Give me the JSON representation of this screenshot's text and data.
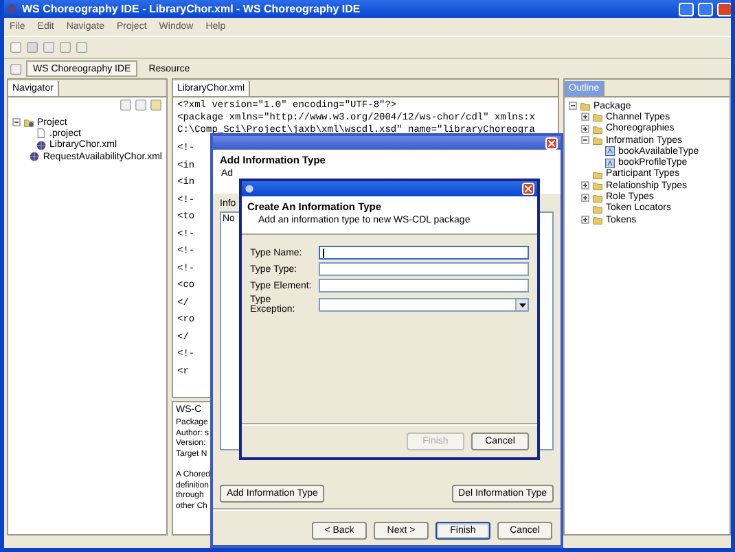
{
  "window": {
    "title": "WS Choreography IDE - LibraryChor.xml - WS Choreography IDE"
  },
  "menu": [
    "File",
    "Edit",
    "Navigate",
    "Project",
    "Window",
    "Help"
  ],
  "perspectives": [
    {
      "label": "WS Choreography IDE",
      "selected": true
    },
    {
      "label": "Resource",
      "selected": false
    }
  ],
  "navigator": {
    "title": "Navigator",
    "tree": [
      {
        "label": "Project",
        "kind": "project",
        "expanded": true,
        "children": [
          {
            "label": ".project",
            "kind": "file"
          },
          {
            "label": "LibraryChor.xml",
            "kind": "chor"
          },
          {
            "label": "RequestAvailabilityChor.xml",
            "kind": "chor"
          }
        ]
      }
    ]
  },
  "editor": {
    "tab": "LibraryChor.xml",
    "header_lines": [
      "<?xml version=\"1.0\" encoding=\"UTF-8\"?>",
      "<package xmlns=\"http://www.w3.org/2004/12/ws-chor/cdl\" xmlns:x",
      "C:\\Comp_Sci\\Project\\jaxb\\xml\\wscdl.xsd\" name=\"libraryChoreogra"
    ],
    "lines": [
      "<!-",
      "<in",
      "<in",
      "<!-",
      "<to",
      "<!-",
      "<!-",
      "<!-",
      "<co",
      "</",
      "<ro",
      "</",
      "<!-",
      "<r"
    ]
  },
  "properties": {
    "tab": "WS-C",
    "lines": [
      "Package",
      "Author: s",
      "Version:",
      "Target N"
    ],
    "description": [
      "A Chored",
      "definition",
      "through",
      "other Ch"
    ]
  },
  "outline": {
    "title": "Outline",
    "tree": [
      {
        "label": "Package",
        "kind": "folder",
        "expanded": true,
        "children": [
          {
            "label": "Channel Types",
            "kind": "folder",
            "expanded": false
          },
          {
            "label": "Choreographies",
            "kind": "folder",
            "expanded": false
          },
          {
            "label": "Information Types",
            "kind": "folder",
            "expanded": true,
            "children": [
              {
                "label": "bookAvailableType",
                "kind": "type"
              },
              {
                "label": "bookProfileType",
                "kind": "type"
              }
            ]
          },
          {
            "label": "Participant Types",
            "kind": "empty-folder"
          },
          {
            "label": "Relationship Types",
            "kind": "folder",
            "expanded": false
          },
          {
            "label": "Role Types",
            "kind": "folder",
            "expanded": false
          },
          {
            "label": "Token Locators",
            "kind": "empty-folder"
          },
          {
            "label": "Tokens",
            "kind": "folder",
            "expanded": false
          }
        ]
      }
    ]
  },
  "wizard": {
    "heading": "Add Information Type",
    "subtitle": "Ad",
    "list_label": "Info",
    "list_item": "No",
    "buttons": [
      {
        "label": "Add Information Type"
      },
      {
        "label": "Del Information Type"
      }
    ],
    "nav_buttons": [
      {
        "label": "< Back",
        "disabled": false,
        "default": false
      },
      {
        "label": "Next >",
        "disabled": false,
        "default": false
      },
      {
        "label": "Finish",
        "disabled": false,
        "default": true
      },
      {
        "label": "Cancel",
        "disabled": false,
        "default": false
      }
    ]
  },
  "dialog": {
    "heading": "Create An Information Type",
    "description": "Add an information type to new WS-CDL package",
    "fields": [
      {
        "label": "Type Name:",
        "kind": "text",
        "focused": true
      },
      {
        "label": "Type Type:",
        "kind": "text",
        "focused": false
      },
      {
        "label": "Type Element:",
        "kind": "text",
        "focused": false
      },
      {
        "label": "Type Exception:",
        "kind": "dropdown",
        "focused": false
      }
    ],
    "buttons": [
      {
        "label": "Finish",
        "disabled": true
      },
      {
        "label": "Cancel",
        "disabled": false
      }
    ]
  }
}
